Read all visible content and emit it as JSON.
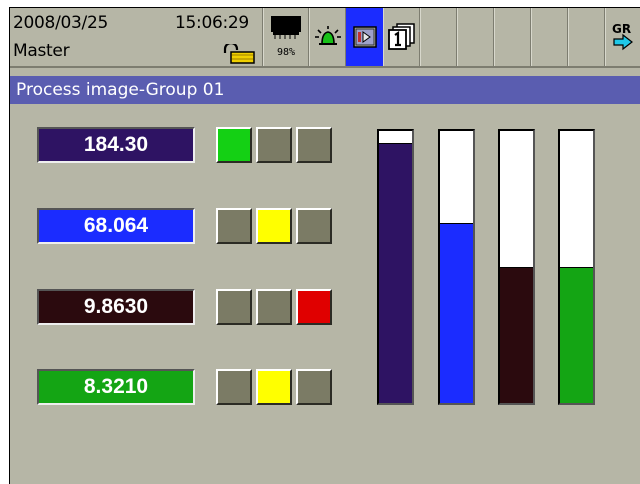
{
  "status": {
    "date": "2008/03/25",
    "time": "15:06:29",
    "user": "Master",
    "memory_percent": "98%"
  },
  "toolbar": {
    "buttons": [
      {
        "name": "memory",
        "icon": "memory-card-icon"
      },
      {
        "name": "alarm",
        "icon": "alarm-bell-icon"
      },
      {
        "name": "display-switch",
        "icon": "display-switch-icon",
        "active": true
      },
      {
        "name": "group-select",
        "icon": "group-number-icon",
        "label": "1"
      },
      {
        "name": "empty-1"
      },
      {
        "name": "empty-2"
      },
      {
        "name": "empty-3"
      },
      {
        "name": "empty-4"
      },
      {
        "name": "empty-5"
      },
      {
        "name": "graph",
        "icon": "graph-arrow-icon",
        "label": "GR"
      }
    ]
  },
  "title": "Process image-Group 01",
  "channels": [
    {
      "value": "184.30",
      "color": "#2e1363",
      "lamps": [
        "#14d014",
        "#7b7b65",
        "#7b7b65"
      ],
      "bar_level": 0.955
    },
    {
      "value": "68.064",
      "color": "#1b2cff",
      "lamps": [
        "#7b7b65",
        "#ffff00",
        "#7b7b65"
      ],
      "bar_level": 0.66
    },
    {
      "value": "9.8630",
      "color": "#2b0a0e",
      "lamps": [
        "#7b7b65",
        "#7b7b65",
        "#e00000"
      ],
      "bar_level": 0.5
    },
    {
      "value": "8.3210",
      "color": "#14a514",
      "lamps": [
        "#7b7b65",
        "#ffff00",
        "#7b7b65"
      ],
      "bar_level": 0.5
    }
  ]
}
